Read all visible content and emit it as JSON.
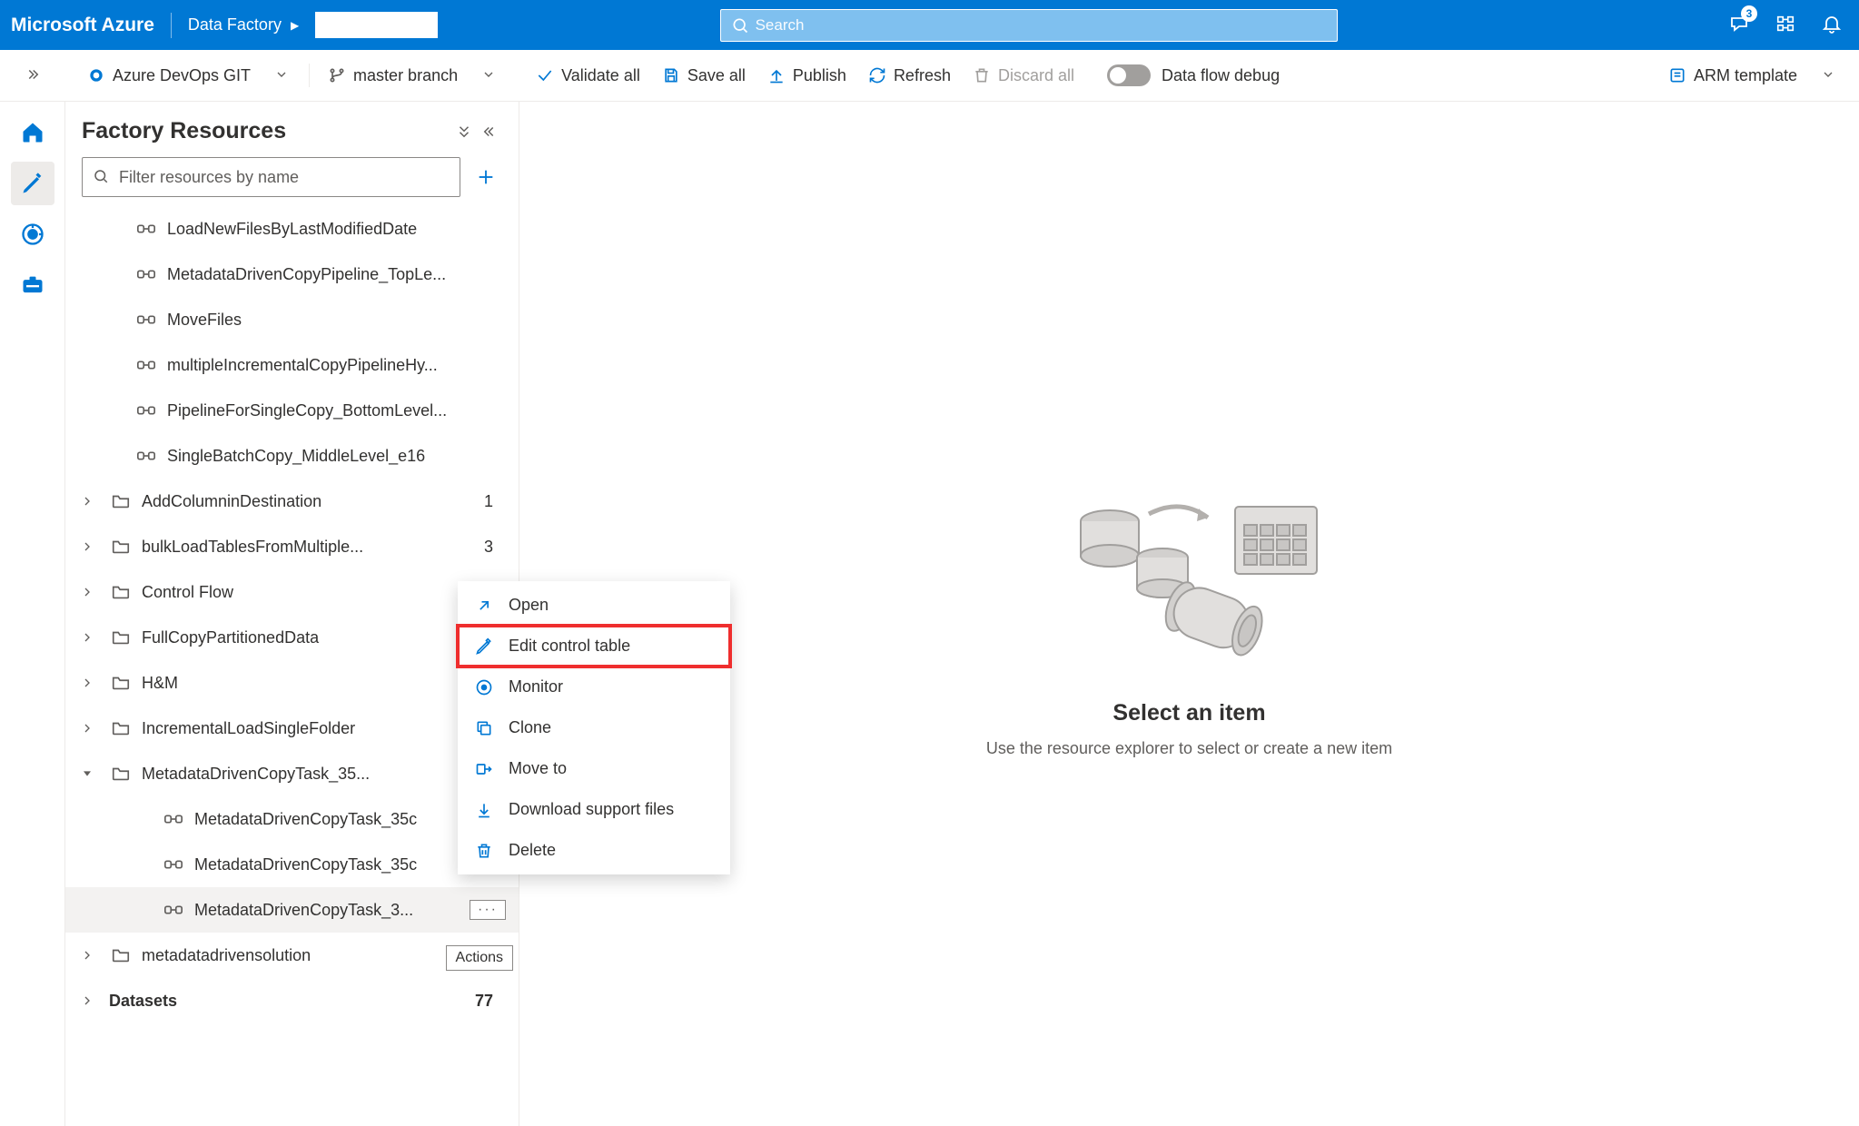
{
  "header": {
    "brand": "Microsoft Azure",
    "service": "Data Factory",
    "search_placeholder": "Search",
    "notification_count": "3"
  },
  "toolbar": {
    "repo_label": "Azure DevOps GIT",
    "branch_label": "master branch",
    "validate_all": "Validate all",
    "save_all": "Save all",
    "publish": "Publish",
    "refresh": "Refresh",
    "discard_all": "Discard all",
    "data_flow_debug": "Data flow debug",
    "arm_template": "ARM template"
  },
  "resources": {
    "title": "Factory Resources",
    "filter_placeholder": "Filter resources by name",
    "tree": [
      {
        "type": "pipeline",
        "label": "LoadNewFilesByLastModifiedDate"
      },
      {
        "type": "pipeline",
        "label": "MetadataDrivenCopyPipeline_TopLe..."
      },
      {
        "type": "pipeline",
        "label": "MoveFiles"
      },
      {
        "type": "pipeline",
        "label": "multipleIncrementalCopyPipelineHy..."
      },
      {
        "type": "pipeline",
        "label": "PipelineForSingleCopy_BottomLevel..."
      },
      {
        "type": "pipeline",
        "label": "SingleBatchCopy_MiddleLevel_e16"
      },
      {
        "type": "folder",
        "caret": "right",
        "label": "AddColumninDestination",
        "count": "1"
      },
      {
        "type": "folder",
        "caret": "right",
        "label": "bulkLoadTablesFromMultiple...",
        "count": "3"
      },
      {
        "type": "folder",
        "caret": "right",
        "label": "Control Flow"
      },
      {
        "type": "folder",
        "caret": "right",
        "label": "FullCopyPartitionedData"
      },
      {
        "type": "folder",
        "caret": "right",
        "label": "H&M"
      },
      {
        "type": "folder",
        "caret": "right",
        "label": "IncrementalLoadSingleFolder"
      },
      {
        "type": "folder",
        "caret": "down",
        "label": "MetadataDrivenCopyTask_35..."
      },
      {
        "type": "child-pipeline",
        "label": "MetadataDrivenCopyTask_35c"
      },
      {
        "type": "child-pipeline",
        "label": "MetadataDrivenCopyTask_35c"
      },
      {
        "type": "child-pipeline",
        "label": "MetadataDrivenCopyTask_3...",
        "selected": true,
        "actions": true
      },
      {
        "type": "folder",
        "caret": "right",
        "label": "metadatadrivensolution",
        "tooltip": "Actions"
      },
      {
        "type": "section",
        "caret": "right",
        "label": "Datasets",
        "count": "77"
      }
    ]
  },
  "context_menu": {
    "items": [
      {
        "icon": "open",
        "label": "Open"
      },
      {
        "icon": "edit",
        "label": "Edit control table",
        "highlighted": true
      },
      {
        "icon": "monitor",
        "label": "Monitor"
      },
      {
        "icon": "clone",
        "label": "Clone"
      },
      {
        "icon": "move",
        "label": "Move to"
      },
      {
        "icon": "download",
        "label": "Download support files"
      },
      {
        "icon": "delete",
        "label": "Delete"
      }
    ]
  },
  "canvas": {
    "title": "Select an item",
    "subtitle": "Use the resource explorer to select or create a new item"
  }
}
